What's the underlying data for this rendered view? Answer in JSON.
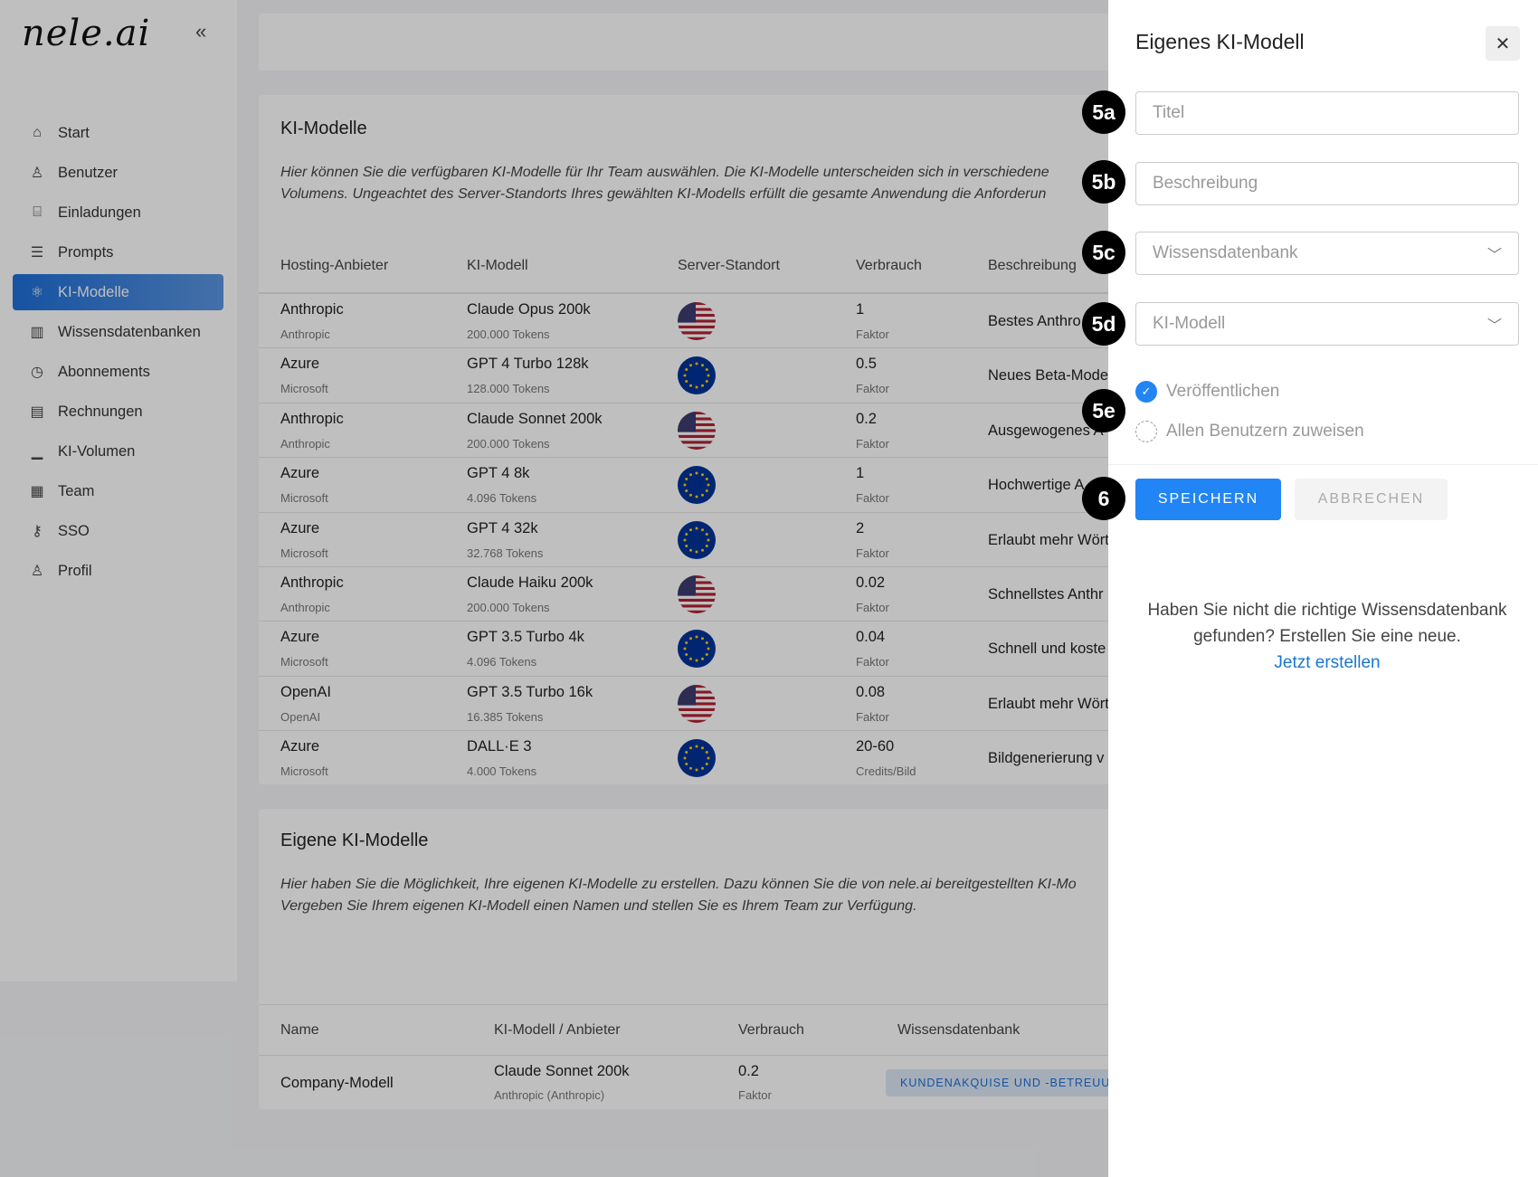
{
  "brand": {
    "logo": "nele.ai"
  },
  "sidebar": {
    "collapse_icon": "double-chevron-left",
    "items": [
      {
        "label": "Start",
        "icon": "home"
      },
      {
        "label": "Benutzer",
        "icon": "user"
      },
      {
        "label": "Einladungen",
        "icon": "mailbox"
      },
      {
        "label": "Prompts",
        "icon": "message-code"
      },
      {
        "label": "KI-Modelle",
        "icon": "atom",
        "active": true
      },
      {
        "label": "Wissensdatenbanken",
        "icon": "books"
      },
      {
        "label": "Abonnements",
        "icon": "clock"
      },
      {
        "label": "Rechnungen",
        "icon": "clipboard"
      },
      {
        "label": "KI-Volumen",
        "icon": "chart"
      },
      {
        "label": "Team",
        "icon": "building"
      },
      {
        "label": "SSO",
        "icon": "key"
      },
      {
        "label": "Profil",
        "icon": "user"
      }
    ]
  },
  "models": {
    "title": "KI-Modelle",
    "description": [
      "Hier können Sie die verfügbaren KI-Modelle für Ihr Team auswählen. Die KI-Modelle unterscheiden sich in verschiedene",
      "Volumens. Ungeachtet des Server-Standorts Ihres gewählten KI-Modells erfüllt die gesamte Anwendung die Anforderun"
    ],
    "columns": [
      "Hosting-Anbieter",
      "KI-Modell",
      "Server-Standort",
      "Verbrauch",
      "Beschreibung"
    ],
    "rows": [
      {
        "host": "Anthropic",
        "host_sub": "Anthropic",
        "model": "Claude Opus 200k",
        "tokens": "200.000 Tokens",
        "flag": "us",
        "usage": "1",
        "unit": "Faktor",
        "desc": "Bestes Anthro"
      },
      {
        "host": "Azure",
        "host_sub": "Microsoft",
        "model": "GPT 4 Turbo 128k",
        "tokens": "128.000 Tokens",
        "flag": "eu",
        "usage": "0.5",
        "unit": "Faktor",
        "desc": "Neues Beta-Mode"
      },
      {
        "host": "Anthropic",
        "host_sub": "Anthropic",
        "model": "Claude Sonnet 200k",
        "tokens": "200.000 Tokens",
        "flag": "us",
        "usage": "0.2",
        "unit": "Faktor",
        "desc": "Ausgewogenes A"
      },
      {
        "host": "Azure",
        "host_sub": "Microsoft",
        "model": "GPT 4 8k",
        "tokens": "4.096 Tokens",
        "flag": "eu",
        "usage": "1",
        "unit": "Faktor",
        "desc": "Hochwertige A"
      },
      {
        "host": "Azure",
        "host_sub": "Microsoft",
        "model": "GPT 4 32k",
        "tokens": "32.768 Tokens",
        "flag": "eu",
        "usage": "2",
        "unit": "Faktor",
        "desc": "Erlaubt mehr Wört"
      },
      {
        "host": "Anthropic",
        "host_sub": "Anthropic",
        "model": "Claude Haiku 200k",
        "tokens": "200.000 Tokens",
        "flag": "us",
        "usage": "0.02",
        "unit": "Faktor",
        "desc": "Schnellstes Anthr"
      },
      {
        "host": "Azure",
        "host_sub": "Microsoft",
        "model": "GPT 3.5 Turbo 4k",
        "tokens": "4.096 Tokens",
        "flag": "eu",
        "usage": "0.04",
        "unit": "Faktor",
        "desc": "Schnell und koste"
      },
      {
        "host": "OpenAI",
        "host_sub": "OpenAI",
        "model": "GPT 3.5 Turbo 16k",
        "tokens": "16.385 Tokens",
        "flag": "us",
        "usage": "0.08",
        "unit": "Faktor",
        "desc": "Erlaubt mehr Wört"
      },
      {
        "host": "Azure",
        "host_sub": "Microsoft",
        "model": "DALL·E 3",
        "tokens": "4.000 Tokens",
        "flag": "eu",
        "usage": "20-60",
        "unit": "Credits/Bild",
        "desc": "Bildgenerierung v"
      }
    ]
  },
  "custom": {
    "title": "Eigene KI-Modelle",
    "description": [
      "Hier haben Sie die Möglichkeit, Ihre eigenen KI-Modelle zu erstellen. Dazu können Sie die von nele.ai bereitgestellten KI-Mo",
      "Vergeben Sie Ihrem eigenen KI-Modell einen Namen und stellen Sie es Ihrem Team zur Verfügung."
    ],
    "columns": [
      "Name",
      "KI-Modell / Anbieter",
      "Verbrauch",
      "Wissensdatenbank"
    ],
    "rows": [
      {
        "name": "Company-Modell",
        "model": "Claude Sonnet 200k",
        "provider": "Anthropic (Anthropic)",
        "usage": "0.2",
        "unit": "Faktor",
        "kb": "KUNDENAKQUISE UND -BETREUUN"
      }
    ]
  },
  "panel": {
    "title": "Eigenes KI-Modell",
    "title_placeholder": "Titel",
    "description_placeholder": "Beschreibung",
    "kb_select": "Wissensdatenbank",
    "model_select": "KI-Modell",
    "publish_label": "Veröffentlichen",
    "publish_checked": true,
    "assign_label": "Allen Benutzern zuweisen",
    "assign_checked": false,
    "save": "SPEICHERN",
    "cancel": "ABBRECHEN",
    "help": "Haben Sie nicht die richtige Wissensdatenbank gefunden? Erstellen Sie eine neue.",
    "help_link": "Jetzt erstellen",
    "accent": "#2185f5"
  },
  "annotations": [
    "5a",
    "5b",
    "5c",
    "5d",
    "5e",
    "6"
  ]
}
